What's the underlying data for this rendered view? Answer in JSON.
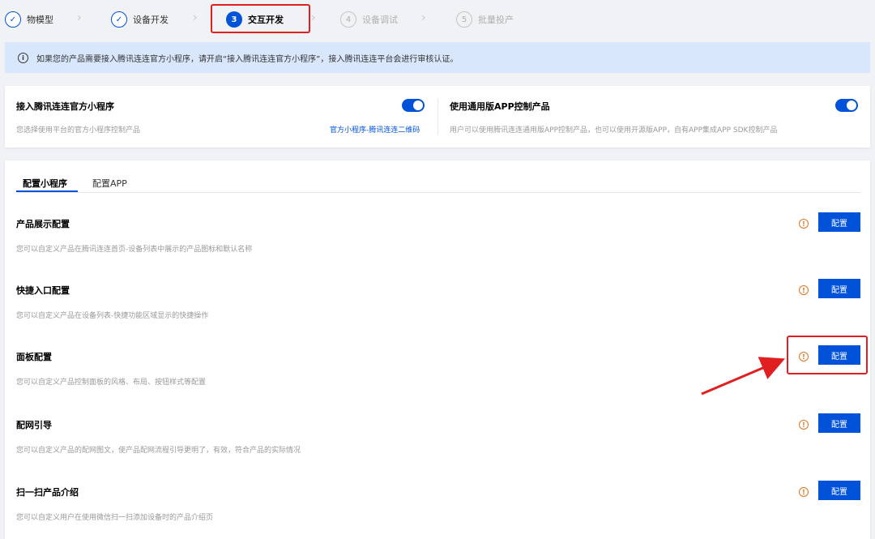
{
  "steps": [
    {
      "num": "✓",
      "label": "物模型",
      "state": "done"
    },
    {
      "num": "✓",
      "label": "设备开发",
      "state": "done"
    },
    {
      "num": "3",
      "label": "交互开发",
      "state": "active"
    },
    {
      "num": "4",
      "label": "设备调试",
      "state": "pending"
    },
    {
      "num": "5",
      "label": "批量投产",
      "state": "pending"
    }
  ],
  "notice": {
    "icon": "info-icon",
    "text": "如果您的产品需要接入腾讯连连官方小程序，请开启“接入腾讯连连官方小程序”，接入腾讯连连平台会进行审核认证。"
  },
  "access": {
    "left": {
      "title": "接入腾讯连连官方小程序",
      "desc": "您选择使用平台的官方小程序控制产品",
      "link": "官方小程序-腾讯连连二维码",
      "enabled": true
    },
    "right": {
      "title": "使用通用版APP控制产品",
      "desc": "用户可以使用腾讯连连通用版APP控制产品，也可以使用开源版APP，自有APP集成APP SDK控制产品",
      "enabled": true
    }
  },
  "tabs": [
    {
      "label": "配置小程序",
      "active": true
    },
    {
      "label": "配置APP",
      "active": false
    }
  ],
  "config_items": [
    {
      "title": "产品展示配置",
      "desc": "您可以自定义产品在腾讯连连首页-设备列表中展示的产品图标和默认名称",
      "button": "配置",
      "warn": "!"
    },
    {
      "title": "快捷入口配置",
      "desc": "您可以自定义产品在设备列表-快捷功能区域显示的快捷操作",
      "button": "配置",
      "warn": "!"
    },
    {
      "title": "面板配置",
      "desc": "您可以自定义产品控制面板的风格、布局、按钮样式等配置",
      "button": "配置",
      "warn": "!"
    },
    {
      "title": "配网引导",
      "desc": "您可以自定义产品的配网图文，使产品配网流程引导更明了，有效，符合产品的实际情况",
      "button": "配置",
      "warn": "!"
    },
    {
      "title": "扫一扫产品介绍",
      "desc": "您可以自定义用户在使用微信扫一扫添加设备时的产品介绍页",
      "button": "配置",
      "warn": "!"
    }
  ],
  "colors": {
    "primary": "#0052d9",
    "annotation": "#e02020",
    "warning": "#e37318",
    "notice_bg": "#d9e7fd"
  }
}
